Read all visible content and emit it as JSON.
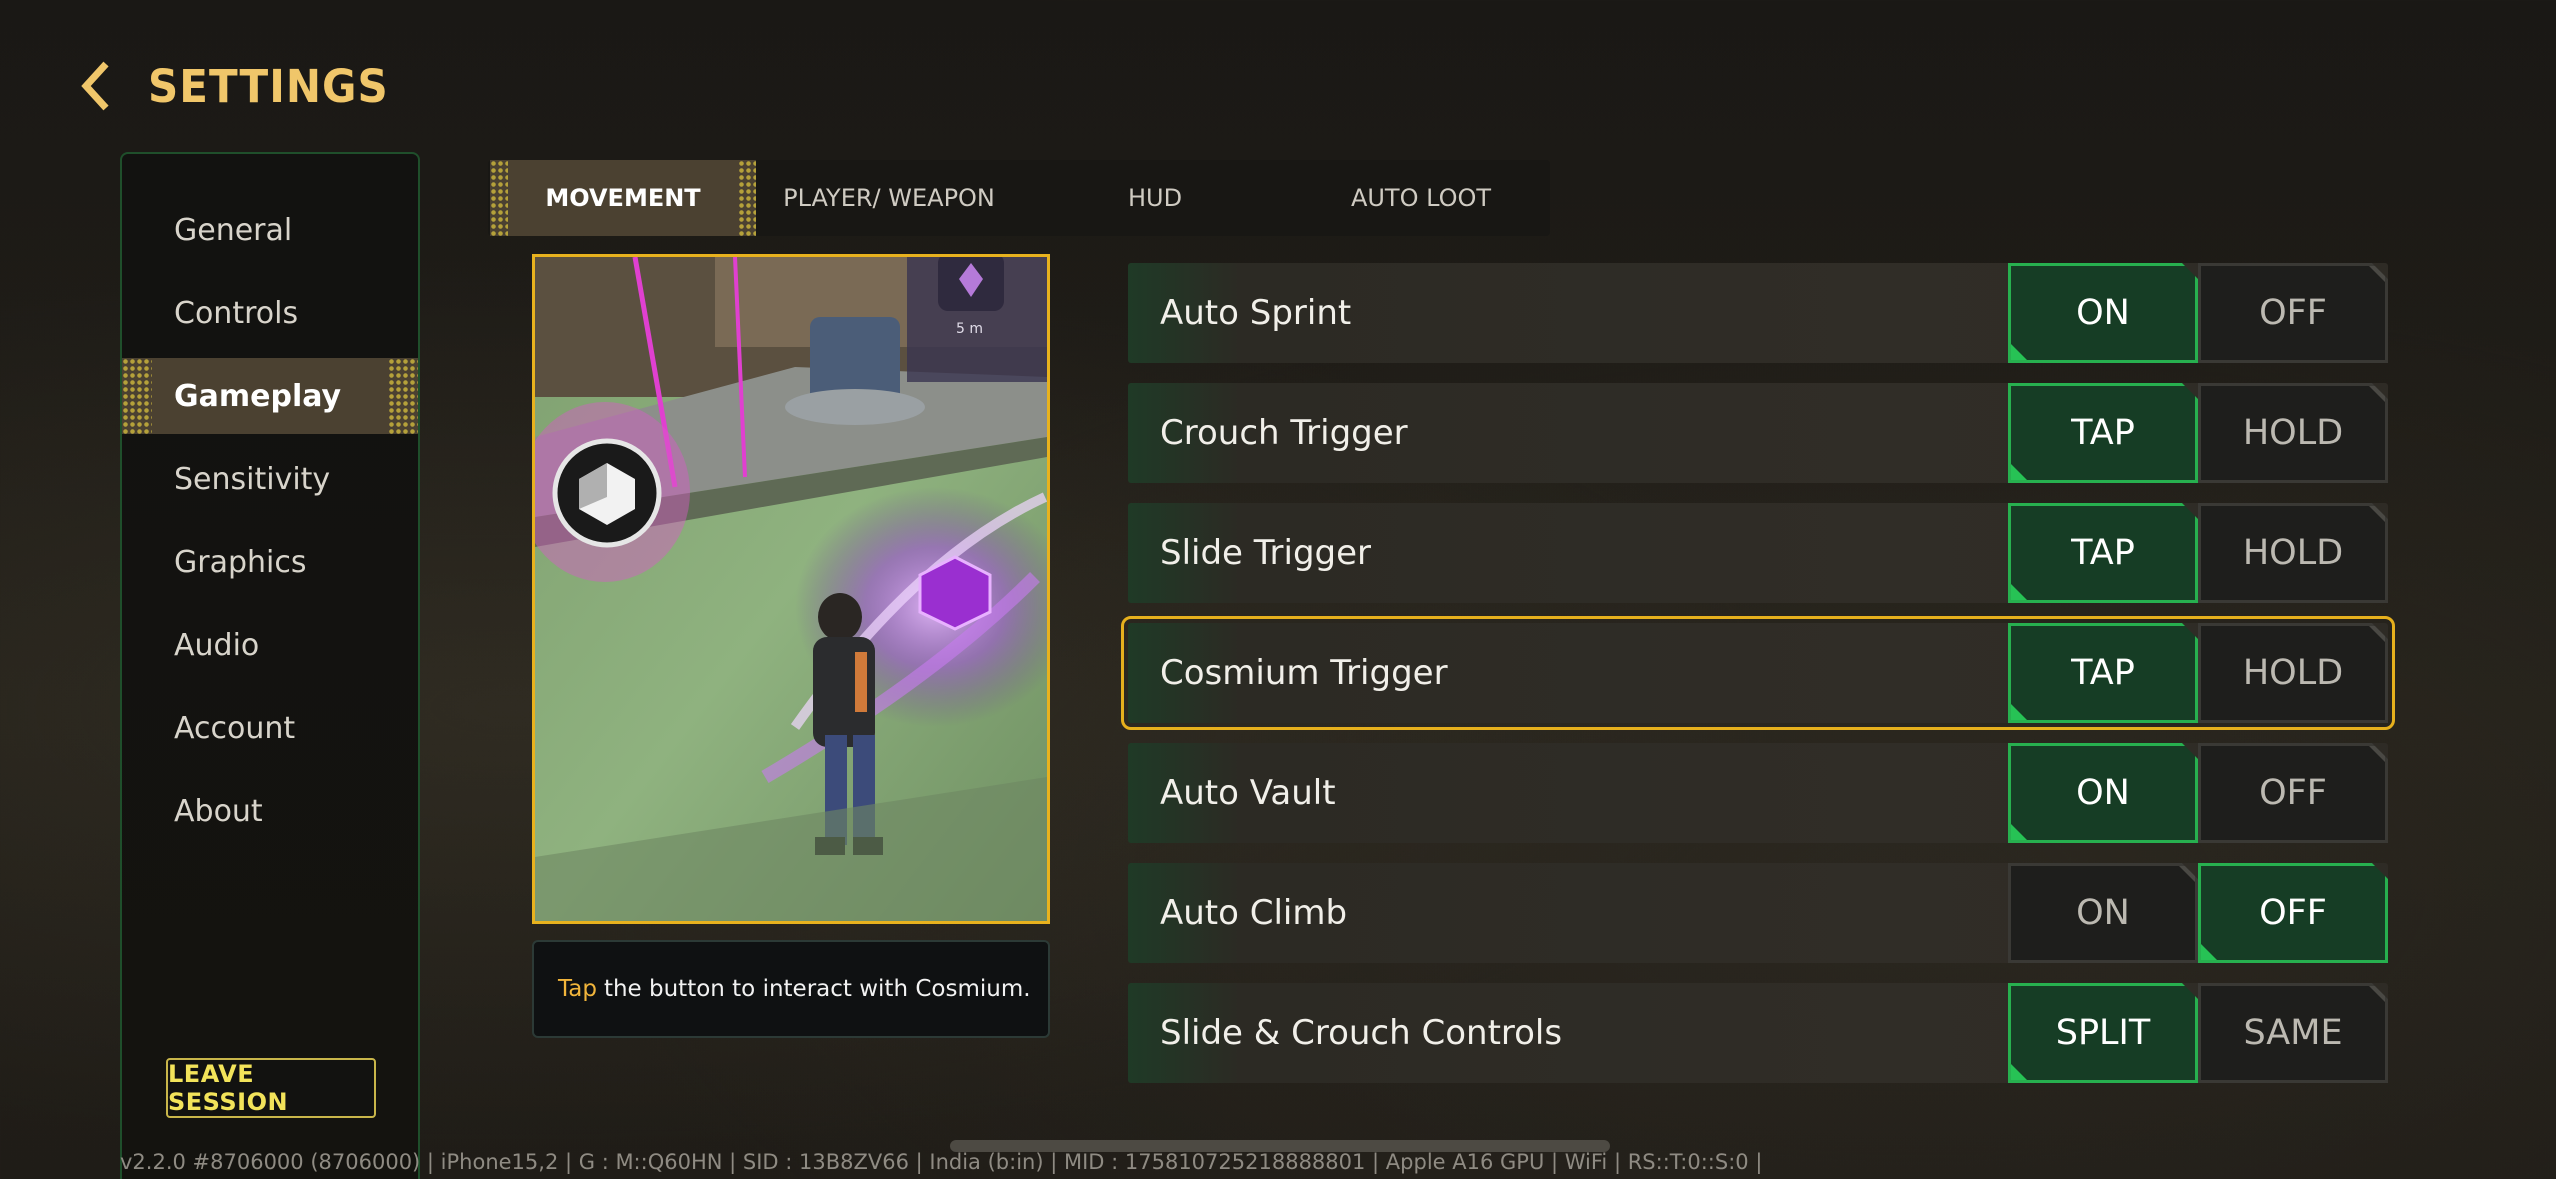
{
  "header": {
    "title": "SETTINGS"
  },
  "sidebar": {
    "items": [
      {
        "label": "General"
      },
      {
        "label": "Controls"
      },
      {
        "label": "Gameplay",
        "active": true
      },
      {
        "label": "Sensitivity"
      },
      {
        "label": "Graphics"
      },
      {
        "label": "Audio"
      },
      {
        "label": "Account"
      },
      {
        "label": "About"
      }
    ],
    "leave_label": "LEAVE SESSION"
  },
  "tabs": [
    {
      "label": "MOVEMENT",
      "active": true
    },
    {
      "label": "PLAYER/ WEAPON"
    },
    {
      "label": "HUD"
    },
    {
      "label": "AUTO LOOT"
    }
  ],
  "preview": {
    "distance_label": "5 m",
    "caption_highlight": "Tap",
    "caption_rest": "the button to interact with Cosmium."
  },
  "settings": [
    {
      "label": "Auto Sprint",
      "options": [
        "ON",
        "OFF"
      ],
      "selected": 0
    },
    {
      "label": "Crouch Trigger",
      "options": [
        "TAP",
        "HOLD"
      ],
      "selected": 0
    },
    {
      "label": "Slide Trigger",
      "options": [
        "TAP",
        "HOLD"
      ],
      "selected": 0
    },
    {
      "label": "Cosmium Trigger",
      "options": [
        "TAP",
        "HOLD"
      ],
      "selected": 0,
      "focused": true
    },
    {
      "label": "Auto Vault",
      "options": [
        "ON",
        "OFF"
      ],
      "selected": 0
    },
    {
      "label": "Auto Climb",
      "options": [
        "ON",
        "OFF"
      ],
      "selected": 1
    },
    {
      "label": "Slide & Crouch Controls",
      "options": [
        "SPLIT",
        "SAME"
      ],
      "selected": 0
    }
  ],
  "footer": {
    "info": "v2.2.0 #8706000 (8706000) | iPhone15,2 | G : M::Q60HN | SID : 13B8ZV66 | India (b:in) | MID : 175810725218888801 | Apple A16 GPU | WiFi | RS::T:0::S:0 |"
  },
  "colors": {
    "accent_gold": "#f0c66a",
    "selected_green": "#27b04f",
    "focus_yellow": "#e6b01d",
    "leave_yellow": "#f2e35a"
  }
}
